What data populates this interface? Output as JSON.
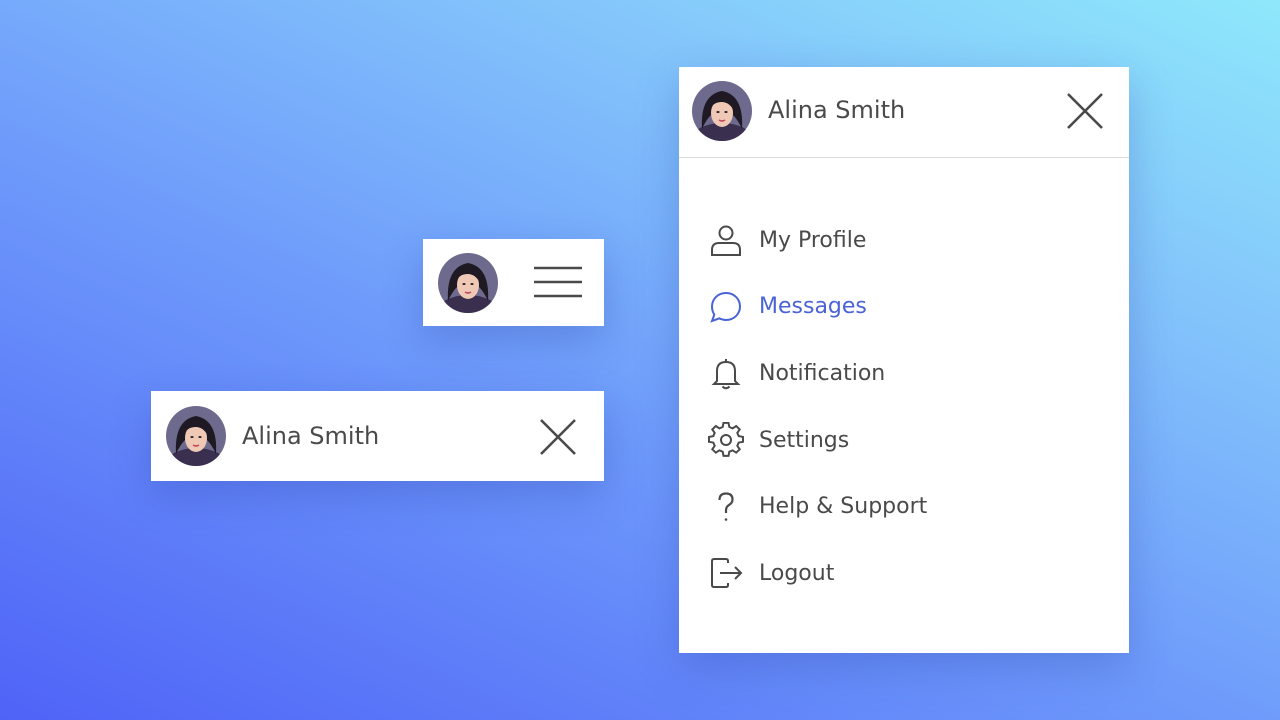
{
  "user": {
    "name": "Alina Smith",
    "avatar_icon": "user-avatar-photo"
  },
  "toggle_card": {
    "menu_icon": "hamburger-icon"
  },
  "header_card": {
    "close_icon": "close-icon"
  },
  "menu": {
    "close_icon": "close-icon",
    "active_color": "#4a63d6",
    "text_color": "#4a4a4a",
    "items": [
      {
        "label": "My Profile",
        "icon": "user-icon",
        "active": false
      },
      {
        "label": "Messages",
        "icon": "chat-bubble-icon",
        "active": true
      },
      {
        "label": "Notification",
        "icon": "bell-icon",
        "active": false
      },
      {
        "label": "Settings",
        "icon": "gear-icon",
        "active": false
      },
      {
        "label": "Help & Support",
        "icon": "question-icon",
        "active": false
      },
      {
        "label": "Logout",
        "icon": "logout-icon",
        "active": false
      }
    ]
  },
  "background": {
    "gradient_start": "#4f63f7",
    "gradient_end": "#8ee8fb"
  }
}
